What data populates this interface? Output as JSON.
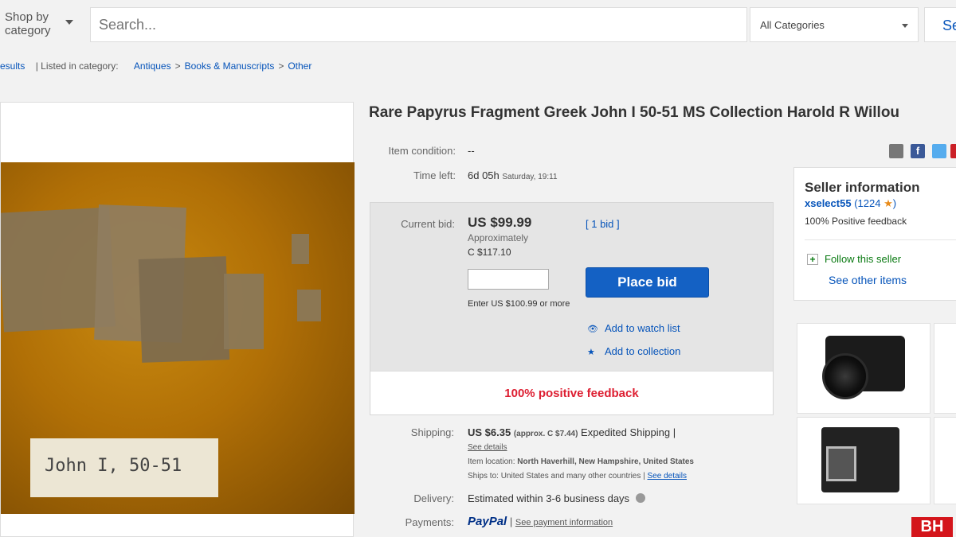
{
  "header": {
    "shop_by": "Shop by category",
    "search_placeholder": "Search...",
    "category_select": "All Categories",
    "search_button": "Se"
  },
  "breadcrumb": {
    "back": "esults",
    "listed_in": "| Listed in category:",
    "items": [
      "Antiques",
      "Books & Manuscripts",
      "Other"
    ]
  },
  "photo": {
    "label": "John I, 50-51"
  },
  "item": {
    "title": "Rare Papyrus Fragment Greek John I 50-51 MS Collection Harold R Willou",
    "condition_label": "Item condition:",
    "condition_value": "--",
    "time_left_label": "Time left:",
    "time_left_value": "6d 05h",
    "time_left_date": "Saturday, 19:11"
  },
  "bid": {
    "current_bid_label": "Current bid:",
    "current_bid_value": "US $99.99",
    "approx_label": "Approximately",
    "approx_value": "C $117.10",
    "bid_count": "[ 1 bid ]",
    "input_value": "",
    "hint": "Enter US $100.99 or more",
    "place_bid_label": "Place bid",
    "watch_list": "Add to watch list",
    "collection": "Add to collection",
    "feedback": "100% positive feedback"
  },
  "shipping": {
    "shipping_label": "Shipping:",
    "shipping_cost": "US $6.35",
    "approx": "(approx. C $7.44)",
    "method": "Expedited Shipping |",
    "see_details": "See details",
    "location_label": "Item location:",
    "location_value": "North Haverhill, New Hampshire, United States",
    "ships_to_label": "Ships to:",
    "ships_to_value": "United States and many other countries |",
    "ships_to_link": "See details",
    "delivery_label": "Delivery:",
    "delivery_value": "Estimated within 3-6 business days",
    "payments_label": "Payments:",
    "payments_logo": "PayPal",
    "payments_link": "See payment information"
  },
  "seller": {
    "heading": "Seller information",
    "username": "xselect55",
    "score": "(1224",
    "score_close": ")",
    "feedback": "100% Positive feedback",
    "follow": "Follow this seller",
    "other_items": "See other items"
  },
  "share": {
    "fb_glyph": "f"
  },
  "ad": {
    "logo": "BH"
  },
  "colors": {
    "link": "#0654ba",
    "place_bid": "#1461c4",
    "feedback_red": "#dd1e31",
    "follow_green": "#0a7a12"
  }
}
